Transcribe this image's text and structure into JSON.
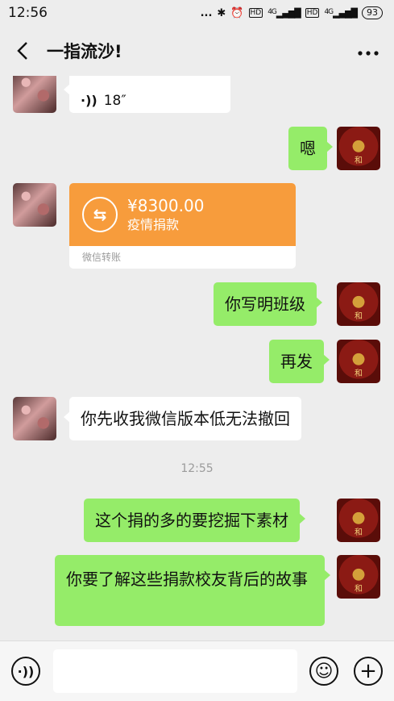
{
  "status_bar": {
    "time": "12:56",
    "dots": "...",
    "bluetooth": "✱",
    "alarm": "⏰",
    "hd1": "HD",
    "net1": "4G",
    "hd2": "HD",
    "net2": "4G",
    "battery": "93"
  },
  "header": {
    "title": "一指流沙!",
    "back_icon": "chevron-left",
    "more_icon": "more-dots"
  },
  "messages": [
    {
      "sender": "friend",
      "type": "voice",
      "duration": "18″"
    },
    {
      "sender": "me",
      "type": "text",
      "text": "嗯"
    },
    {
      "sender": "friend",
      "type": "transfer",
      "amount": "¥8300.00",
      "note": "疫情捐款",
      "footer": "微信转账"
    },
    {
      "sender": "me",
      "type": "text",
      "text": "你写明班级"
    },
    {
      "sender": "me",
      "type": "text",
      "text": "再发"
    },
    {
      "sender": "friend",
      "type": "text",
      "text": "你先收我微信版本低无法撤回"
    },
    {
      "type": "time",
      "text": "12:55"
    },
    {
      "sender": "me",
      "type": "text",
      "text": "这个捐的多的要挖掘下素材"
    },
    {
      "sender": "me",
      "type": "text",
      "text": "你要了解这些捐款校友背后的故事"
    }
  ],
  "avatar_label": "和",
  "input_bar": {
    "voice_icon": "voice-icon",
    "emoji_icon": "emoji-icon",
    "plus_icon": "plus-icon",
    "input_value": ""
  }
}
